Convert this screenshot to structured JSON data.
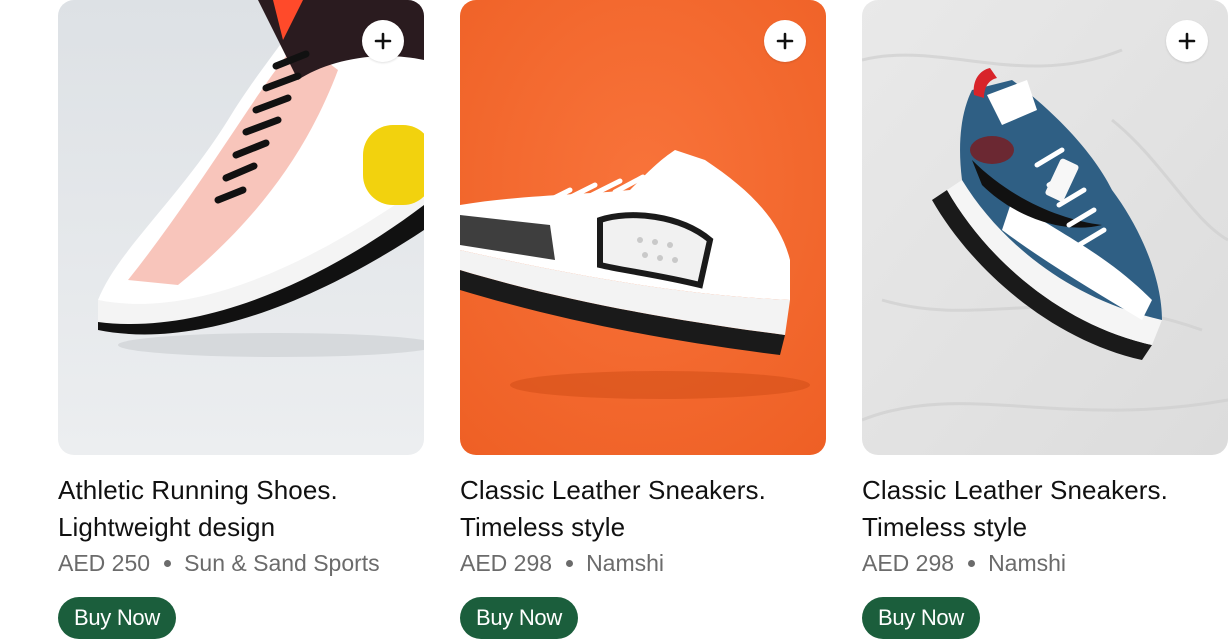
{
  "products": [
    {
      "title_line1": "Athletic Running Shoes.",
      "title_line2": "Lightweight design",
      "price": "AED 250",
      "seller": "Sun & Sand Sports",
      "buy_label": "Buy Now",
      "add_icon": "plus-icon",
      "image_bg": "#e3e6e9"
    },
    {
      "title_line1": "Classic Leather Sneakers.",
      "title_line2": "Timeless style",
      "price": "AED 298",
      "seller": "Namshi",
      "buy_label": "Buy Now",
      "add_icon": "plus-icon",
      "image_bg": "#f2692f"
    },
    {
      "title_line1": "Classic Leather Sneakers.",
      "title_line2": "Timeless style",
      "price": "AED 298",
      "seller": "Namshi",
      "buy_label": "Buy Now",
      "add_icon": "plus-icon",
      "image_bg": "#e6e6e6"
    }
  ],
  "colors": {
    "buy_button": "#1b5e3c",
    "text_primary": "#111111",
    "text_secondary": "#6b6b6b"
  }
}
